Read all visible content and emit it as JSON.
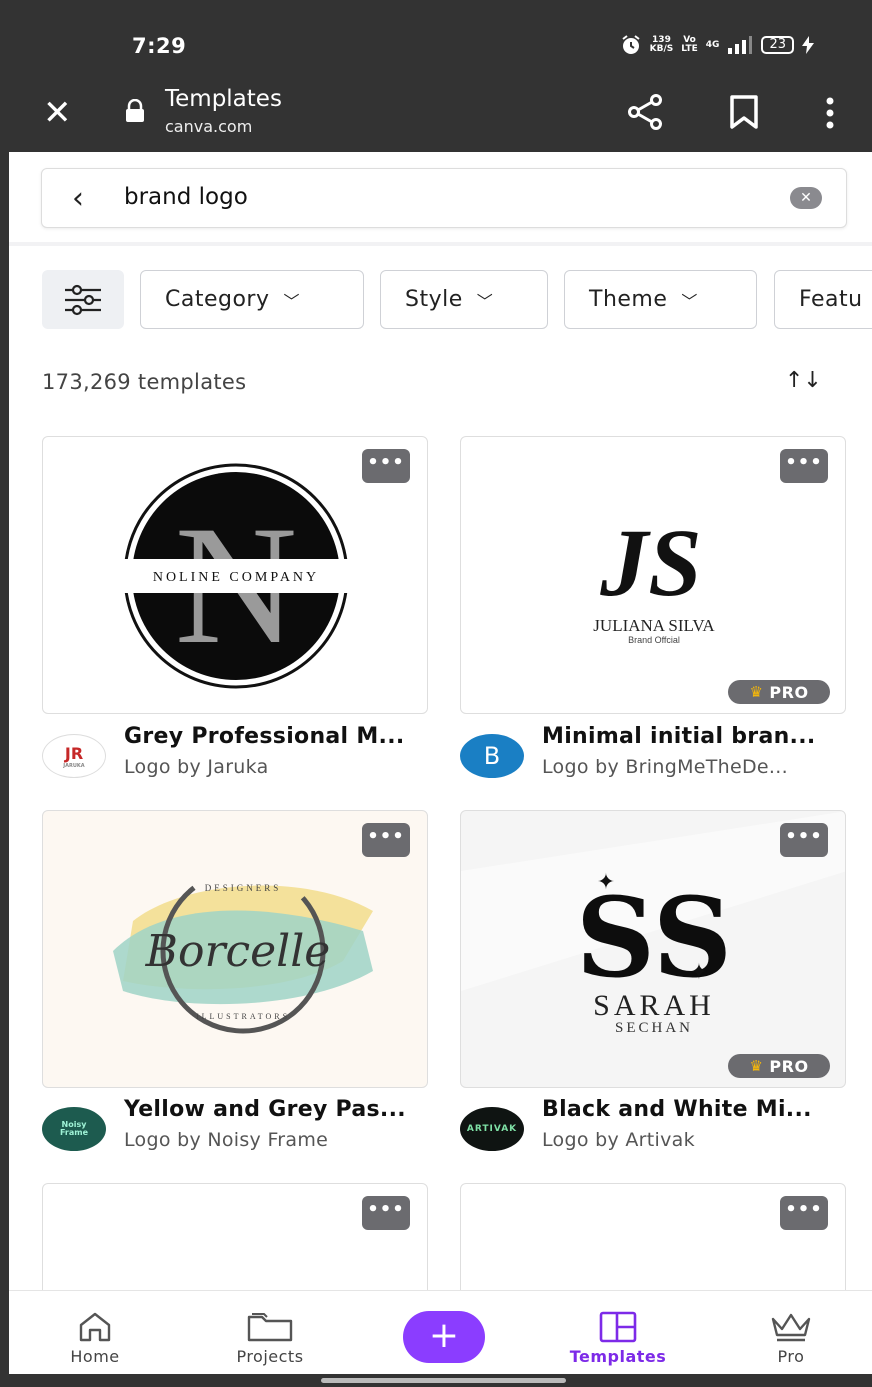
{
  "status_bar": {
    "time": "7:29",
    "net_speed": "139",
    "net_unit": "KB/S",
    "volte_top": "Vo",
    "volte_bottom": "LTE",
    "signal": "4G",
    "battery": "23"
  },
  "browser": {
    "title": "Templates",
    "url": "canva.com"
  },
  "search": {
    "query": "brand logo"
  },
  "filters": [
    {
      "label": "Category"
    },
    {
      "label": "Style"
    },
    {
      "label": "Theme"
    },
    {
      "label": "Featu"
    }
  ],
  "results": {
    "count_text": "173,269 templates"
  },
  "templates": [
    {
      "title": "Grey Professional M...",
      "author": "Logo by Jaruka",
      "avatar_text": "JR",
      "avatar_sub": "JARUKA",
      "preview_text": "NOLINE COMPANY",
      "preview_letter": "N",
      "pro": false
    },
    {
      "title": "Minimal initial bran...",
      "author": "Logo by BringMeTheDe...",
      "avatar_text": "B",
      "preview_text": "JULIANA SILVA",
      "preview_sub": "Brand Offcial",
      "preview_letter": "JS",
      "pro": true,
      "pro_label": "PRO"
    },
    {
      "title": "Yellow and Grey Pas...",
      "author": "Logo by Noisy Frame",
      "avatar_text": "Noisy Frame",
      "preview_text": "Borcelle",
      "preview_top": "DESIGNERS",
      "preview_bottom": "ILLUSTRATORS",
      "pro": false
    },
    {
      "title": "Black and White Mi...",
      "author": "Logo by Artivak",
      "avatar_text": "ARTIVAK",
      "preview_text": "SARAH",
      "preview_sub": "SECHAN",
      "preview_letter": "SS",
      "pro": true,
      "pro_label": "PRO"
    }
  ],
  "card_menu": "•••",
  "nav": [
    {
      "label": "Home"
    },
    {
      "label": "Projects"
    },
    {
      "label": "+"
    },
    {
      "label": "Templates"
    },
    {
      "label": "Pro"
    }
  ],
  "colors": {
    "accent": "#8b3dff",
    "active_nav": "#7d2ae8",
    "header": "#333333"
  }
}
